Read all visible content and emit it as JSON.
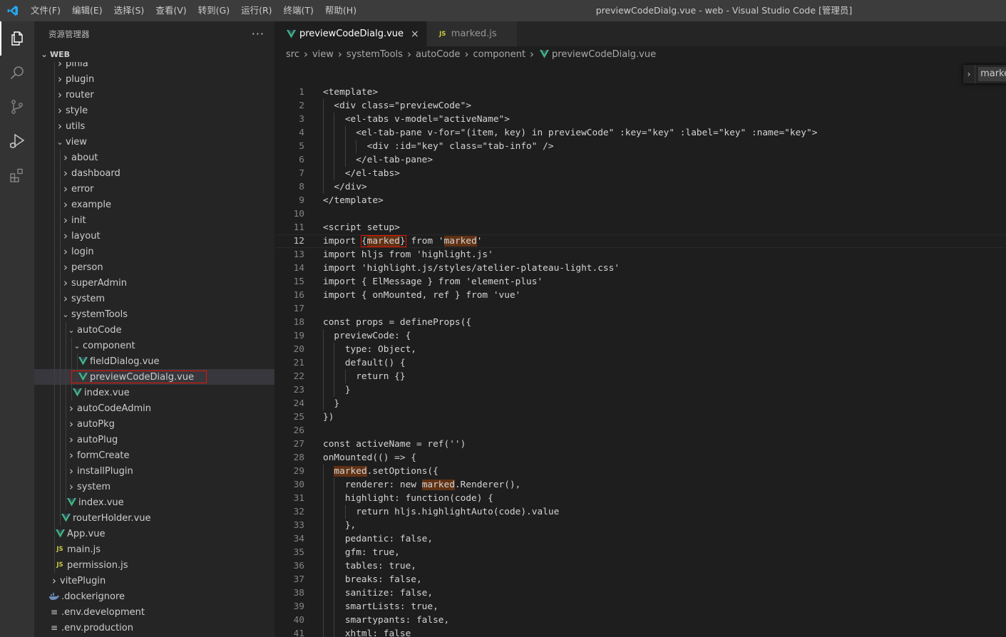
{
  "titlebar": {
    "menu": [
      "文件(F)",
      "编辑(E)",
      "选择(S)",
      "查看(V)",
      "转到(G)",
      "运行(R)",
      "终端(T)",
      "帮助(H)"
    ],
    "window_title": "previewCodeDialg.vue - web - Visual Studio Code [管理员]"
  },
  "activitybar": {
    "icons": [
      "explorer-icon",
      "search-icon",
      "source-control-icon",
      "run-debug-icon",
      "extensions-icon"
    ]
  },
  "sidebar": {
    "title": "资源管理器",
    "more": "···",
    "workspace": "WEB",
    "tree": [
      {
        "label": "pinia",
        "depth": 1,
        "kind": "folder",
        "open": false
      },
      {
        "label": "plugin",
        "depth": 1,
        "kind": "folder",
        "open": false
      },
      {
        "label": "router",
        "depth": 1,
        "kind": "folder",
        "open": false
      },
      {
        "label": "style",
        "depth": 1,
        "kind": "folder",
        "open": false
      },
      {
        "label": "utils",
        "depth": 1,
        "kind": "folder",
        "open": false
      },
      {
        "label": "view",
        "depth": 1,
        "kind": "folder",
        "open": true
      },
      {
        "label": "about",
        "depth": 2,
        "kind": "folder",
        "open": false
      },
      {
        "label": "dashboard",
        "depth": 2,
        "kind": "folder",
        "open": false
      },
      {
        "label": "error",
        "depth": 2,
        "kind": "folder",
        "open": false
      },
      {
        "label": "example",
        "depth": 2,
        "kind": "folder",
        "open": false
      },
      {
        "label": "init",
        "depth": 2,
        "kind": "folder",
        "open": false
      },
      {
        "label": "layout",
        "depth": 2,
        "kind": "folder",
        "open": false
      },
      {
        "label": "login",
        "depth": 2,
        "kind": "folder",
        "open": false
      },
      {
        "label": "person",
        "depth": 2,
        "kind": "folder",
        "open": false
      },
      {
        "label": "superAdmin",
        "depth": 2,
        "kind": "folder",
        "open": false
      },
      {
        "label": "system",
        "depth": 2,
        "kind": "folder",
        "open": false
      },
      {
        "label": "systemTools",
        "depth": 2,
        "kind": "folder",
        "open": true
      },
      {
        "label": "autoCode",
        "depth": 3,
        "kind": "folder",
        "open": true
      },
      {
        "label": "component",
        "depth": 4,
        "kind": "folder",
        "open": true
      },
      {
        "label": "fieldDialog.vue",
        "depth": 5,
        "kind": "vue"
      },
      {
        "label": "previewCodeDialg.vue",
        "depth": 5,
        "kind": "vue",
        "selected": true
      },
      {
        "label": "index.vue",
        "depth": 4,
        "kind": "vue"
      },
      {
        "label": "autoCodeAdmin",
        "depth": 3,
        "kind": "folder",
        "open": false
      },
      {
        "label": "autoPkg",
        "depth": 3,
        "kind": "folder",
        "open": false
      },
      {
        "label": "autoPlug",
        "depth": 3,
        "kind": "folder",
        "open": false
      },
      {
        "label": "formCreate",
        "depth": 3,
        "kind": "folder",
        "open": false
      },
      {
        "label": "installPlugin",
        "depth": 3,
        "kind": "folder",
        "open": false
      },
      {
        "label": "system",
        "depth": 3,
        "kind": "folder",
        "open": false
      },
      {
        "label": "index.vue",
        "depth": 3,
        "kind": "vue"
      },
      {
        "label": "routerHolder.vue",
        "depth": 2,
        "kind": "vue"
      },
      {
        "label": "App.vue",
        "depth": 1,
        "kind": "vue"
      },
      {
        "label": "main.js",
        "depth": 1,
        "kind": "js"
      },
      {
        "label": "permission.js",
        "depth": 1,
        "kind": "js"
      },
      {
        "label": "vitePlugin",
        "depth": 0,
        "kind": "folder",
        "open": false
      },
      {
        "label": ".dockerignore",
        "depth": 0,
        "kind": "docker"
      },
      {
        "label": ".env.development",
        "depth": 0,
        "kind": "text"
      },
      {
        "label": ".env.production",
        "depth": 0,
        "kind": "text"
      }
    ]
  },
  "tabs": [
    {
      "label": "previewCodeDialg.vue",
      "kind": "vue",
      "active": true,
      "close": "×"
    },
    {
      "label": "marked.js",
      "kind": "js",
      "active": false
    }
  ],
  "breadcrumb": [
    "src",
    "view",
    "systemTools",
    "autoCode",
    "component",
    "previewCodeDialg.vue"
  ],
  "find_widget": {
    "chevron": "›",
    "value": "marke"
  },
  "editor": {
    "current_line": 12,
    "lines": [
      "<template>",
      "  <div class=\"previewCode\">",
      "    <el-tabs v-model=\"activeName\">",
      "      <el-tab-pane v-for=\"(item, key) in previewCode\" :key=\"key\" :label=\"key\" :name=\"key\">",
      "        <div :id=\"key\" class=\"tab-info\" />",
      "      </el-tab-pane>",
      "    </el-tabs>",
      "  </div>",
      "</template>",
      "",
      "<script setup>",
      "import {marked} from 'marked'",
      "import hljs from 'highlight.js'",
      "import 'highlight.js/styles/atelier-plateau-light.css'",
      "import { ElMessage } from 'element-plus'",
      "import { onMounted, ref } from 'vue'",
      "",
      "const props = defineProps({",
      "  previewCode: {",
      "    type: Object,",
      "    default() {",
      "      return {}",
      "    }",
      "  }",
      "})",
      "",
      "const activeName = ref('')",
      "onMounted(() => {",
      "  marked.setOptions({",
      "    renderer: new marked.Renderer(),",
      "    highlight: function(code) {",
      "      return hljs.highlightAuto(code).value",
      "    },",
      "    pedantic: false,",
      "    gfm: true,",
      "    tables: true,",
      "    breaks: false,",
      "    sanitize: false,",
      "    smartLists: true,",
      "    smartypants: false,",
      "    xhtml: false"
    ],
    "highlights": [
      {
        "line": 12,
        "term": "marked",
        "occurrence": 1,
        "boxed": true
      },
      {
        "line": 12,
        "term": "marked",
        "occurrence": 2,
        "boxed": false
      },
      {
        "line": 29,
        "term": "marked",
        "occurrence": 1,
        "boxed": false
      },
      {
        "line": 30,
        "term": "marked",
        "occurrence": 1,
        "boxed": false
      }
    ]
  },
  "colors": {
    "vue_icon": "#41b883",
    "js_icon": "#cbcb41",
    "find_highlight": "#613214",
    "annotation_box": "#e51400"
  }
}
